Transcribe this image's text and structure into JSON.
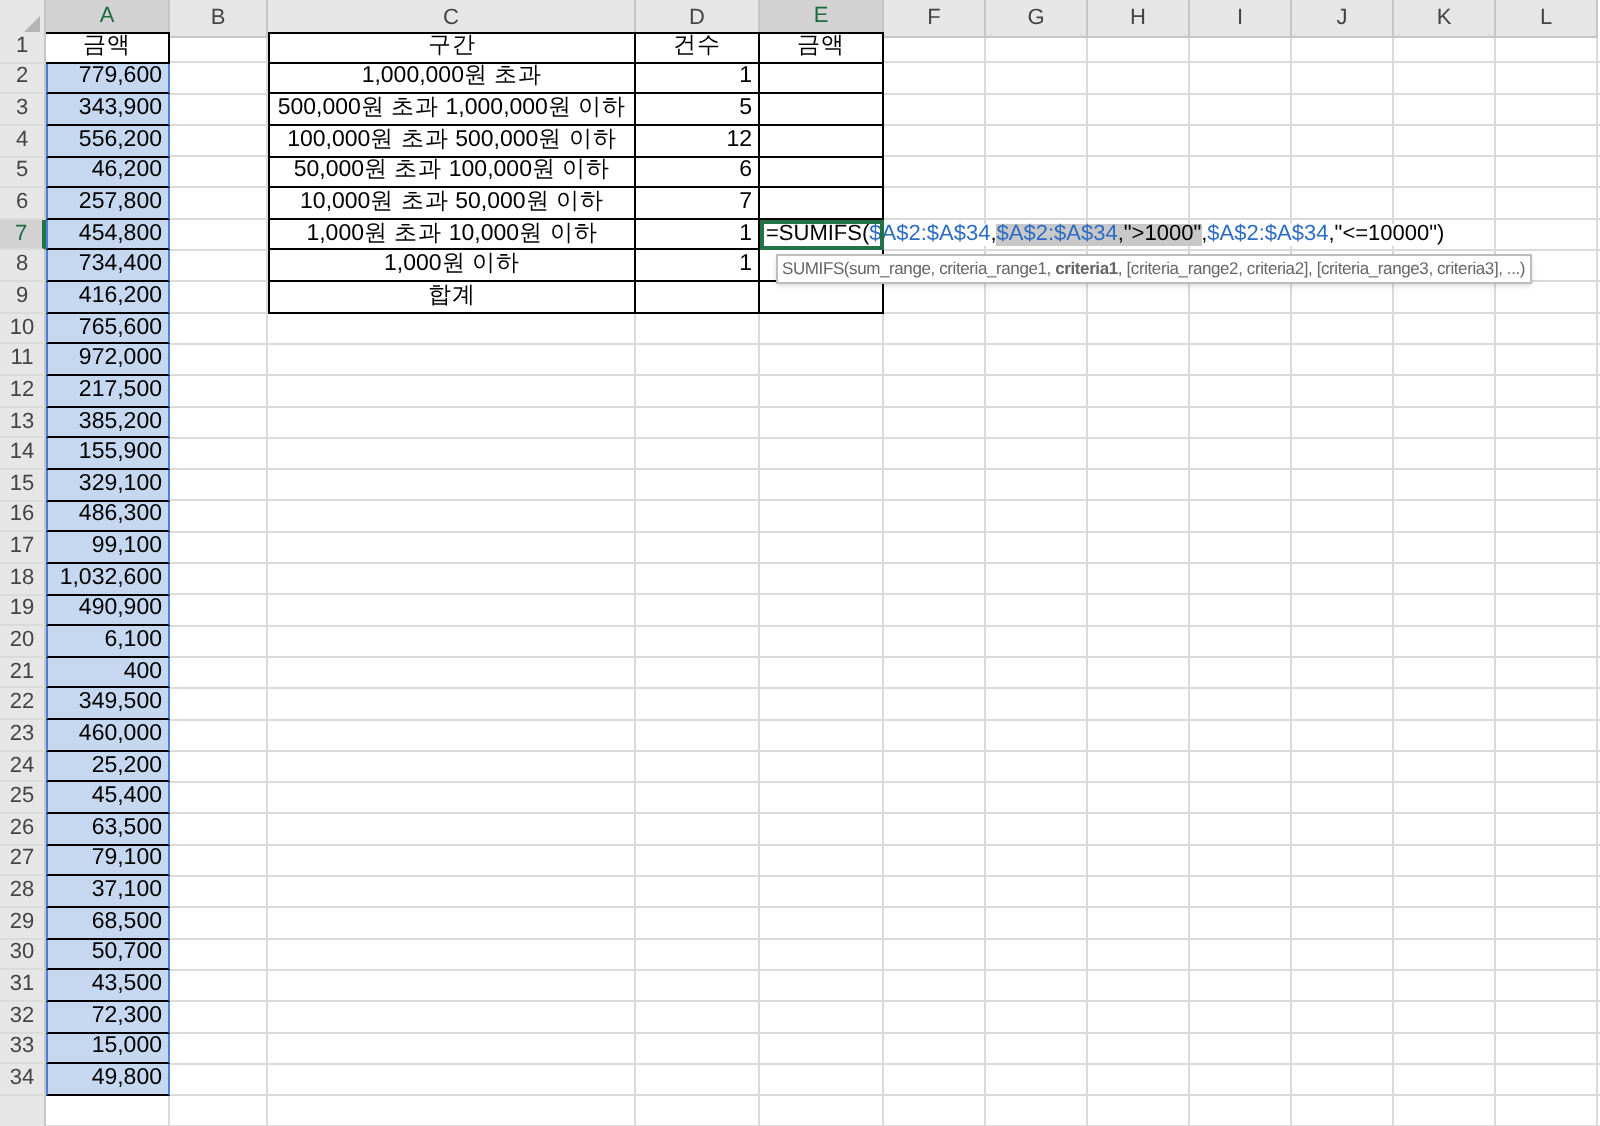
{
  "column_headers": [
    {
      "label": "A",
      "selected": true
    },
    {
      "label": "B",
      "selected": false
    },
    {
      "label": "C",
      "selected": false
    },
    {
      "label": "D",
      "selected": false
    },
    {
      "label": "E",
      "selected": true
    },
    {
      "label": "F",
      "selected": false
    },
    {
      "label": "G",
      "selected": false
    },
    {
      "label": "H",
      "selected": false
    },
    {
      "label": "I",
      "selected": false
    },
    {
      "label": "J",
      "selected": false
    },
    {
      "label": "K",
      "selected": false
    },
    {
      "label": "L",
      "selected": false
    }
  ],
  "row_headers": [
    {
      "label": "1",
      "selected": false
    },
    {
      "label": "2",
      "selected": false
    },
    {
      "label": "3",
      "selected": false
    },
    {
      "label": "4",
      "selected": false
    },
    {
      "label": "5",
      "selected": false
    },
    {
      "label": "6",
      "selected": false
    },
    {
      "label": "7",
      "selected": true
    },
    {
      "label": "8",
      "selected": false
    },
    {
      "label": "9",
      "selected": false
    },
    {
      "label": "10",
      "selected": false
    },
    {
      "label": "11",
      "selected": false
    },
    {
      "label": "12",
      "selected": false
    },
    {
      "label": "13",
      "selected": false
    },
    {
      "label": "14",
      "selected": false
    },
    {
      "label": "15",
      "selected": false
    },
    {
      "label": "16",
      "selected": false
    },
    {
      "label": "17",
      "selected": false
    },
    {
      "label": "18",
      "selected": false
    },
    {
      "label": "19",
      "selected": false
    },
    {
      "label": "20",
      "selected": false
    },
    {
      "label": "21",
      "selected": false
    },
    {
      "label": "22",
      "selected": false
    },
    {
      "label": "23",
      "selected": false
    },
    {
      "label": "24",
      "selected": false
    },
    {
      "label": "25",
      "selected": false
    },
    {
      "label": "26",
      "selected": false
    },
    {
      "label": "27",
      "selected": false
    },
    {
      "label": "28",
      "selected": false
    },
    {
      "label": "29",
      "selected": false
    },
    {
      "label": "30",
      "selected": false
    },
    {
      "label": "31",
      "selected": false
    },
    {
      "label": "32",
      "selected": false
    },
    {
      "label": "33",
      "selected": false
    },
    {
      "label": "34",
      "selected": false
    }
  ],
  "amounts": {
    "header": "금액",
    "selected": true,
    "values": [
      "779,600",
      "343,900",
      "556,200",
      "46,200",
      "257,800",
      "454,800",
      "734,400",
      "416,200",
      "765,600",
      "972,000",
      "217,500",
      "385,200",
      "155,900",
      "329,100",
      "486,300",
      "99,100",
      "1,032,600",
      "490,900",
      "6,100",
      "400",
      "349,500",
      "460,000",
      "25,200",
      "45,400",
      "63,500",
      "79,100",
      "37,100",
      "68,500",
      "50,700",
      "43,500",
      "72,300",
      "15,000",
      "49,800"
    ]
  },
  "summary_table": {
    "columns": [
      "구간",
      "건수",
      "금액"
    ],
    "rows": [
      {
        "range": "1,000,000원 초과",
        "count": "1"
      },
      {
        "range": "500,000원 초과 1,000,000원 이하",
        "count": "5"
      },
      {
        "range": "100,000원 초과 500,000원 이하",
        "count": "12"
      },
      {
        "range": "50,000원 초과 100,000원 이하",
        "count": "6"
      },
      {
        "range": "10,000원 초과 50,000원 이하",
        "count": "7"
      },
      {
        "range": "1,000원 초과 10,000원 이하",
        "count": "1",
        "editing": {
          "formula_parts": [
            {
              "text": "=SUMIFS(",
              "kind": "text",
              "highlighted": false
            },
            {
              "text": "$A$2:$A$34",
              "kind": "ref",
              "highlighted": false
            },
            {
              "text": ",",
              "kind": "text",
              "highlighted": false
            },
            {
              "text": "$A$2:$A$34",
              "kind": "ref",
              "highlighted": true
            },
            {
              "text": ",\">1000\"",
              "kind": "text",
              "highlighted": true
            },
            {
              "text": ",",
              "kind": "text",
              "highlighted": false
            },
            {
              "text": "$A$2:$A$34",
              "kind": "ref",
              "highlighted": false
            },
            {
              "text": ",\"<=10000\")",
              "kind": "text",
              "highlighted": false
            }
          ],
          "tooltip": "SUMIFS(sum_range, criteria_range1, **criteria1**, [criteria_range2, criteria2], [criteria_range3, criteria3], ...)"
        }
      },
      {
        "range": "1,000원 이하",
        "count": "1"
      }
    ],
    "total_label": "합계"
  }
}
